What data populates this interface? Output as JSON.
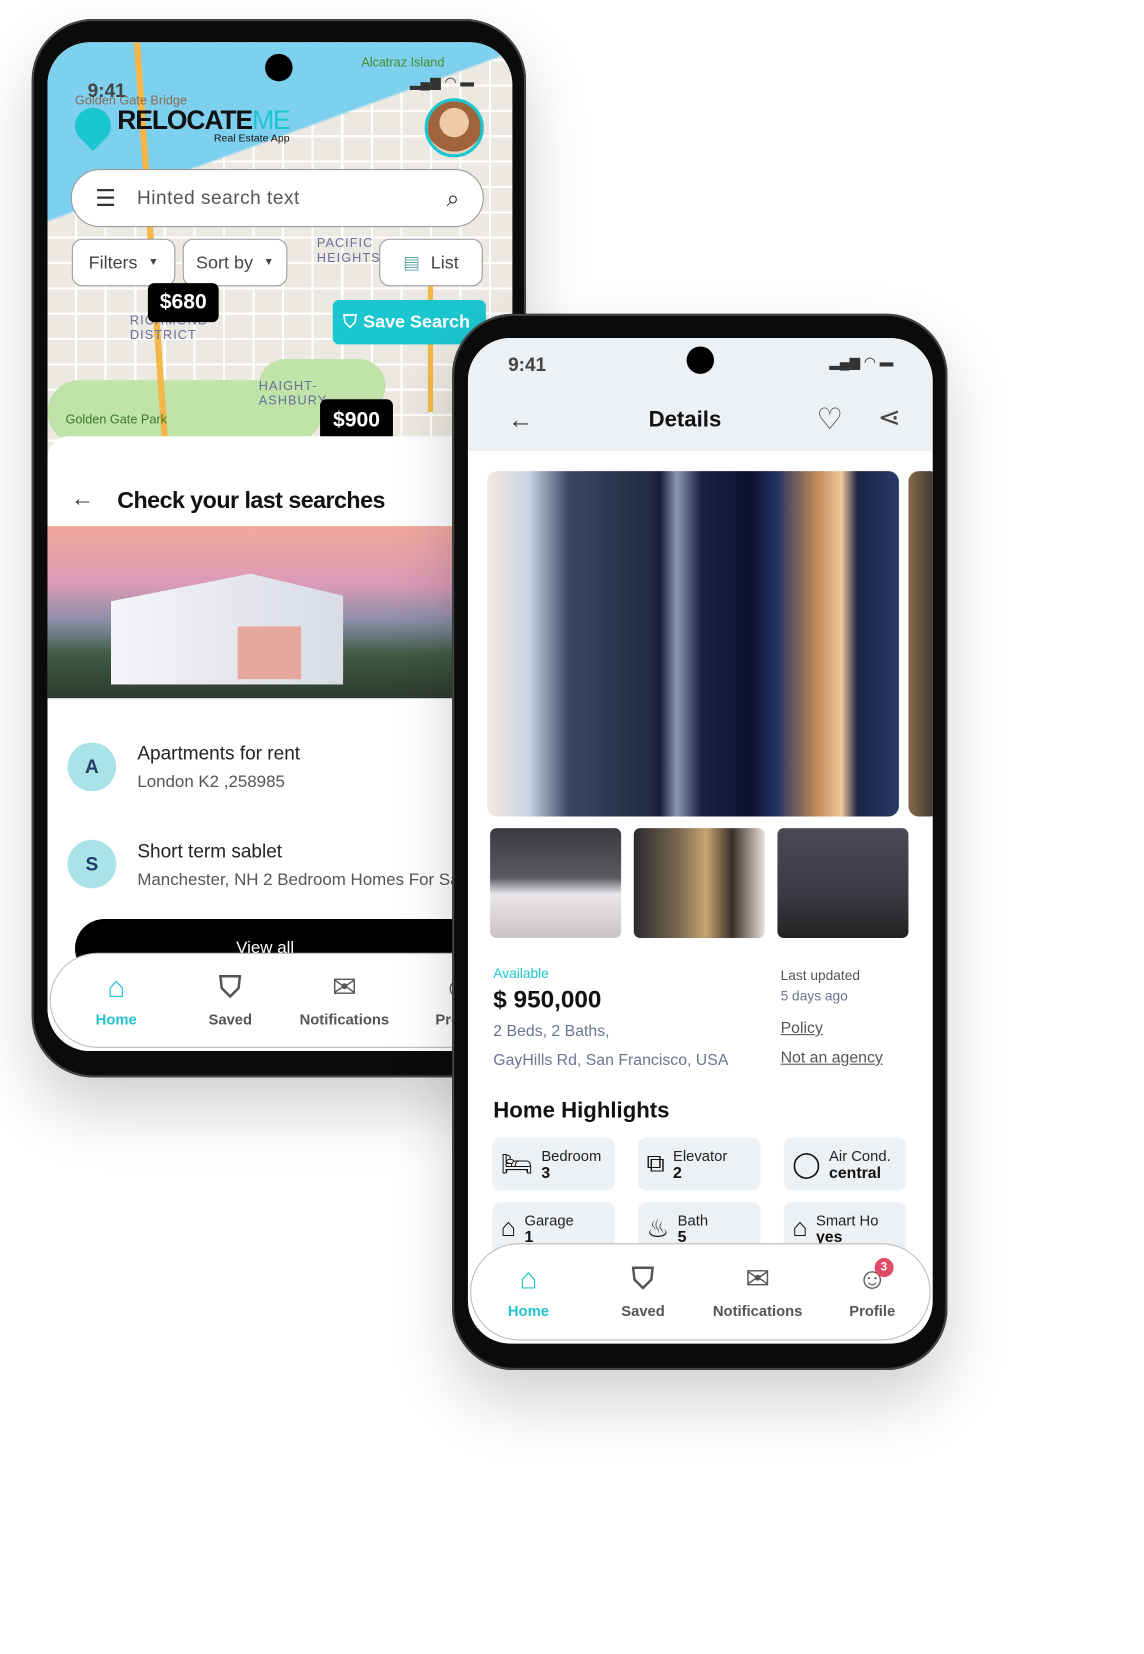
{
  "search_screen": {
    "status_time": "9:41",
    "map_labels": [
      "Golden Gate Bridge",
      "Alcatraz Island",
      "PACIFIC HEIGHTS",
      "RICHMOND DISTRICT",
      "HAIGHT-ASHBURY",
      "Golden Gate Park"
    ],
    "logo": {
      "text_dark": "RELOCATE",
      "text_accent": "ME",
      "tagline": "Real Estate App"
    },
    "search_placeholder": "Hinted search text",
    "filters_label": "Filters",
    "sort_label": "Sort by",
    "list_label": "List",
    "price_tags": [
      "$680",
      "$900"
    ],
    "save_search_label": "Save Search",
    "sheet_title": "Check your last searches",
    "recent": [
      {
        "initial": "A",
        "title": "Apartments for rent",
        "subtitle": "London K2 ,258985"
      },
      {
        "initial": "S",
        "title": "Short term sablet",
        "subtitle": "Manchester, NH 2 Bedroom Homes For Sale"
      }
    ],
    "view_all_label": "View all",
    "nav": [
      "Home",
      "Saved",
      "Notifications",
      "Profile"
    ]
  },
  "details_screen": {
    "status_time": "9:41",
    "title": "Details",
    "availability": "Available",
    "price": "$ 950,000",
    "specs": "2 Beds, 2 Baths,",
    "address": "GayHills Rd, San Francisco, USA",
    "last_updated_label": "Last updated",
    "last_updated_value": "5 days ago",
    "policy_link": "Policy",
    "agency_link": "Not an agency",
    "highlights_title": "Home Highlights",
    "highlights": [
      {
        "icon": "bed-icon",
        "label": "Bedroom",
        "value": "3"
      },
      {
        "icon": "elevator-icon",
        "label": "Elevator",
        "value": "2"
      },
      {
        "icon": "air-cond-icon",
        "label": "Air Cond.",
        "value": "central"
      },
      {
        "icon": "garage-icon",
        "label": "Garage",
        "value": "1"
      },
      {
        "icon": "bath-icon",
        "label": "Bath",
        "value": "5"
      },
      {
        "icon": "smart-home-icon",
        "label": "Smart Ho",
        "value": "yes"
      }
    ],
    "carousel_pages": 4,
    "carousel_active": 1,
    "nav": [
      "Home",
      "Saved",
      "Notifications",
      "Profile"
    ],
    "profile_badge": "3"
  },
  "colors": {
    "accent": "#1cc6cf",
    "badge": "#e24a6a",
    "muted": "#6b7590"
  }
}
